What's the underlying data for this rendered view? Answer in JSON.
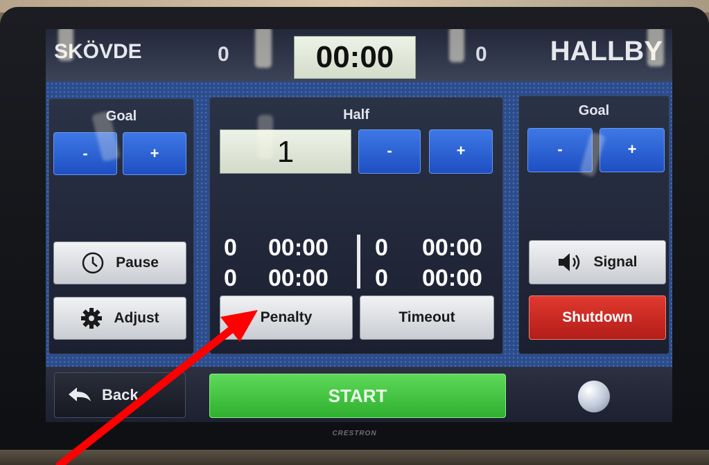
{
  "scoreboard": {
    "home_team": "SKÖVDE",
    "home_score": "0",
    "away_team": "HALLBY",
    "away_score": "0",
    "game_clock": "00:00"
  },
  "left_panel": {
    "goal_title": "Goal",
    "minus_label": "-",
    "plus_label": "+",
    "pause_label": "Pause",
    "adjust_label": "Adjust"
  },
  "center_panel": {
    "half_title": "Half",
    "half_value": "1",
    "minus_label": "-",
    "plus_label": "+",
    "penalties_left": [
      {
        "player": "0",
        "time": "00:00"
      },
      {
        "player": "0",
        "time": "00:00"
      }
    ],
    "penalties_right": [
      {
        "player": "0",
        "time": "00:00"
      },
      {
        "player": "0",
        "time": "00:00"
      }
    ],
    "penalty_label": "Penalty",
    "timeout_label": "Timeout"
  },
  "right_panel": {
    "goal_title": "Goal",
    "minus_label": "-",
    "plus_label": "+",
    "signal_label": "Signal",
    "shutdown_label": "Shutdown"
  },
  "bottom_bar": {
    "back_label": "Back",
    "start_label": "START"
  },
  "device": {
    "brand": "CRESTRON"
  },
  "icons": [
    "clock-icon",
    "gear-icon",
    "speaker-icon",
    "back-arrow-icon",
    "ball-icon"
  ],
  "colors": {
    "accent_blue": "#2a5fd4",
    "start_green": "#3cc43a",
    "shutdown_red": "#cc2a22",
    "annotation_arrow": "#ff0000"
  }
}
